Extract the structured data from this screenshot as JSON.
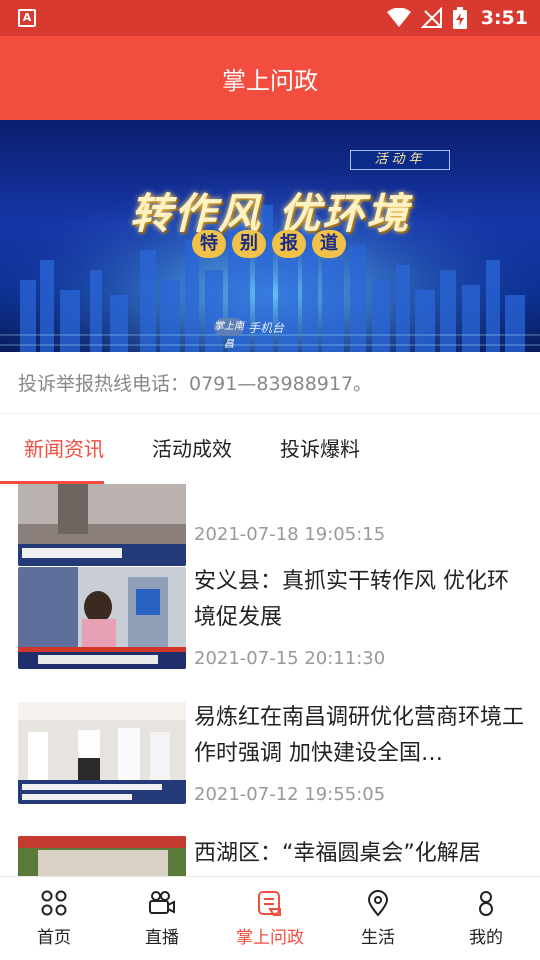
{
  "status_bar": {
    "time": "3:51",
    "app_icon_letter": "A"
  },
  "header": {
    "title": "掌上问政"
  },
  "banner": {
    "badge": "活动年",
    "headline": "转作风 优环境",
    "subtitle_chars": [
      "特",
      "别",
      "报",
      "道"
    ],
    "logo_mark": "掌上南昌",
    "logo_text": "手机台"
  },
  "hotline": {
    "text": "投诉举报热线电话：0791—83988917。"
  },
  "tabs": [
    {
      "label": "新闻资讯",
      "active": true
    },
    {
      "label": "活动成效",
      "active": false
    },
    {
      "label": "投诉爆料",
      "active": false
    }
  ],
  "news": [
    {
      "title": "",
      "date": "2021-07-18 19:05:15"
    },
    {
      "title": "安义县：真抓实干转作风 优化环境促发展",
      "date": "2021-07-15 20:11:30"
    },
    {
      "title": "易炼红在南昌调研优化营商环境工作时强调 加快建设全国…",
      "date": "2021-07-12 19:55:05"
    },
    {
      "title": "西湖区：“幸福圆桌会”化解居",
      "date": ""
    }
  ],
  "bottom_nav": [
    {
      "label": "首页",
      "icon": "grid-icon",
      "active": false
    },
    {
      "label": "直播",
      "icon": "video-camera-icon",
      "active": false
    },
    {
      "label": "掌上问政",
      "icon": "message-doc-icon",
      "active": true
    },
    {
      "label": "生活",
      "icon": "location-pin-icon",
      "active": false
    },
    {
      "label": "我的",
      "icon": "person-icon",
      "active": false
    }
  ],
  "colors": {
    "primary": "#f24d3e",
    "status_bar": "#d93a30",
    "date_gray": "#999999"
  }
}
